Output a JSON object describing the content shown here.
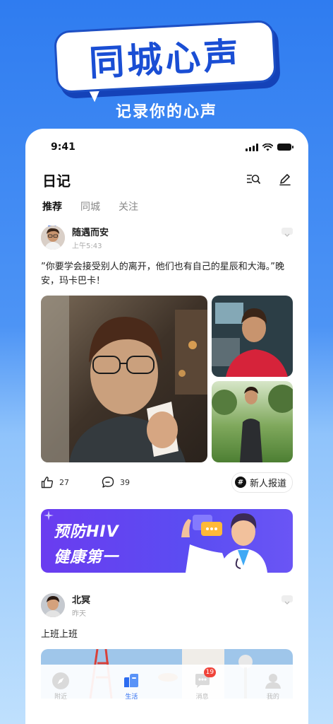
{
  "promo": {
    "title": "同城心声",
    "subtitle": "记录你的心声"
  },
  "status": {
    "time": "9:41"
  },
  "header": {
    "title": "日记"
  },
  "tabs": [
    {
      "label": "推荐",
      "active": true
    },
    {
      "label": "同城",
      "active": false
    },
    {
      "label": "关注",
      "active": false
    }
  ],
  "posts": [
    {
      "username": "随遇而安",
      "time": "上午5:43",
      "text": "”你要学会接受别人的离开，他们也有自己的星辰和大海。”晚安，玛卡巴卡！",
      "likes": "27",
      "comments": "39",
      "topic": "新人报道"
    },
    {
      "username": "北冥",
      "time": "昨天",
      "text": "上班上班"
    }
  ],
  "ad": {
    "line1": "预防HIV",
    "line2": "健康第一"
  },
  "tabbar": [
    {
      "label": "附近",
      "icon": "compass-icon",
      "active": false
    },
    {
      "label": "生活",
      "icon": "life-icon",
      "active": true
    },
    {
      "label": "消息",
      "icon": "message-icon",
      "active": false,
      "badge": "19"
    },
    {
      "label": "我的",
      "icon": "profile-icon",
      "active": false
    }
  ],
  "colors": {
    "accent": "#1f5ce8",
    "banner": "#2f7cf0",
    "ad": "#5b4df2",
    "badge": "#f0443a"
  }
}
